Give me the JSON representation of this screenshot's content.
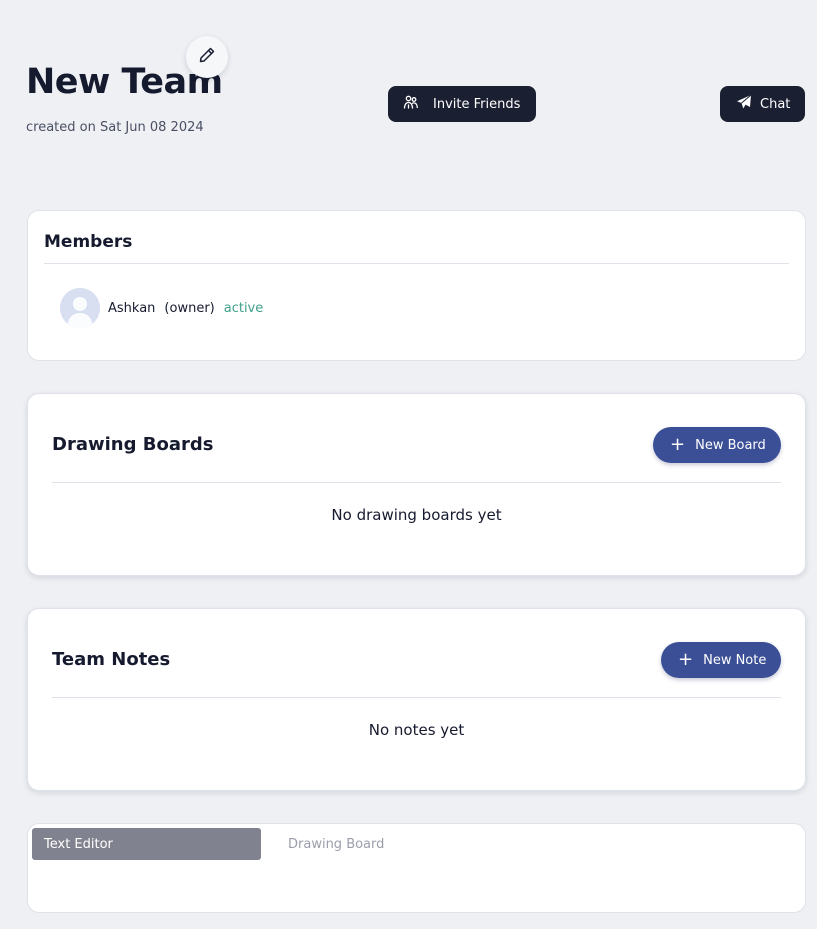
{
  "team": {
    "title": "New Team",
    "created": "created on Sat Jun 08 2024"
  },
  "actions": {
    "invite_label": "Invite Friends",
    "chat_label": "Chat"
  },
  "members": {
    "title": "Members",
    "list": [
      {
        "name": "Ashkan",
        "role": "(owner)",
        "status": "active"
      }
    ]
  },
  "boards": {
    "title": "Drawing Boards",
    "new_label": "New Board",
    "empty": "No drawing boards yet"
  },
  "notes": {
    "title": "Team Notes",
    "new_label": "New Note",
    "empty": "No notes yet"
  },
  "editor": {
    "tabs": [
      "Text Editor",
      "Drawing Board"
    ],
    "active_tab": "Text Editor"
  },
  "icons": {
    "edit": "pencil-icon",
    "invite": "users-icon",
    "chat": "paper-plane-icon",
    "add": "plus-icon"
  },
  "colors": {
    "background": "#eef0f4",
    "dark_button": "#1a1f32",
    "accent_button": "#3b4f97",
    "status_active": "#3f9f8a",
    "active_tab": "#80838f"
  }
}
